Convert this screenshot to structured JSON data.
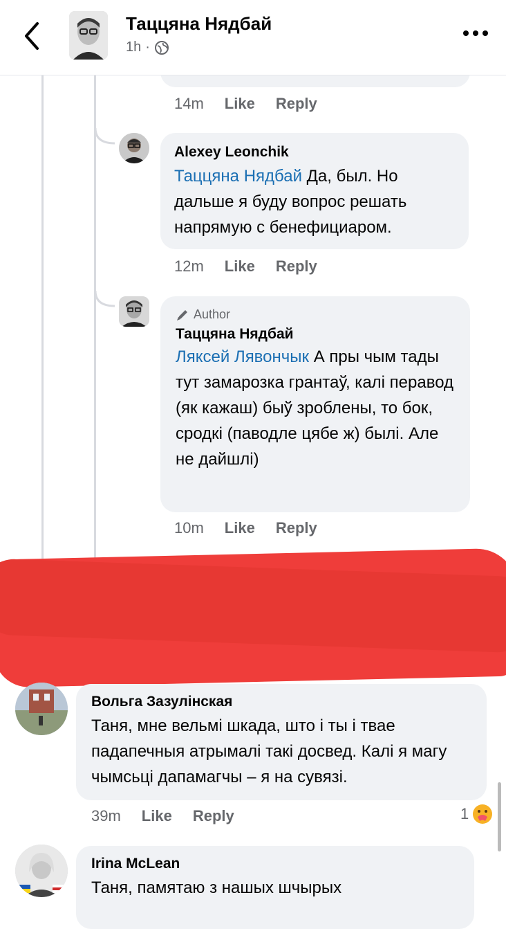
{
  "header": {
    "title": "Тацця‌на Нядбай",
    "time": "1h",
    "dot": "·"
  },
  "colors": {
    "mention": "#1b6fb3",
    "bubble": "#f0f2f5",
    "redaction": "#ef3d3a"
  },
  "comments": [
    {
      "time": "14m",
      "like": "Like",
      "reply": "Reply"
    },
    {
      "author": "Alexey Leonchik",
      "mention": "Тацця‌на Нядбай",
      "text": " Да, был. Но дальше я буду вопрос решать напрямую с бенефициаром.",
      "time": "12m",
      "like": "Like",
      "reply": "Reply"
    },
    {
      "badge": "Author",
      "author": "Тацця‌на Нядбай",
      "mention": "Ляксей Лявончык",
      "text": " А пры чым тады тут замарозка грантаў, калі перавод (як кажаш) быў зроблены, то бок, сродкі (паводле цябе ж) былі. Але не дайшлі)",
      "time": "10m",
      "like": "Like",
      "reply": "Reply"
    },
    {
      "author": "Вольга Зазулінская",
      "text": "Таня, мне вельмі шкада, што і ты і твае падапечныя атрымалі такі досвед. Калі я магу чымсьці дапамагчы – я на сувязі.",
      "time": "39m",
      "like": "Like",
      "reply": "Reply",
      "reaction_count": "1"
    },
    {
      "author": "Irina McLean",
      "text": "Таня, памятаю з нашых шчырых"
    }
  ]
}
